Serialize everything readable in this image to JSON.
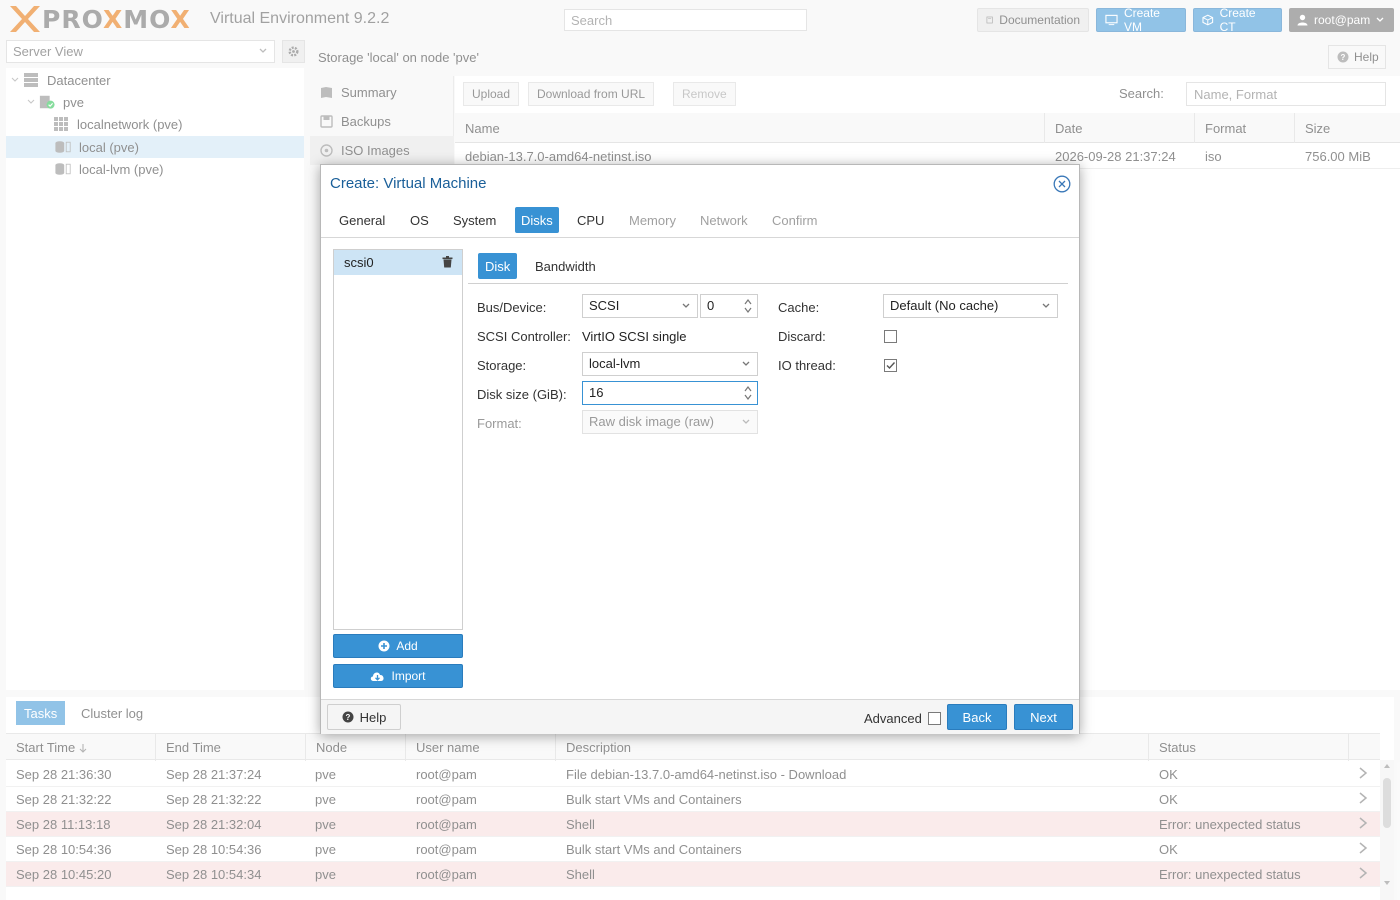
{
  "header": {
    "logo_text": "PROXMOX",
    "version": "Virtual Environment 9.2.2",
    "search_placeholder": "Search",
    "documentation": "Documentation",
    "create_vm": "Create VM",
    "create_ct": "Create CT",
    "user": "root@pam"
  },
  "sidebar": {
    "view": "Server View",
    "tree": [
      {
        "label": "Datacenter"
      },
      {
        "label": "pve"
      },
      {
        "label": "localnetwork (pve)"
      },
      {
        "label": "local (pve)"
      },
      {
        "label": "local-lvm (pve)"
      }
    ]
  },
  "content": {
    "title": "Storage 'local' on node 'pve'",
    "help": "Help",
    "nav": [
      "Summary",
      "Backups",
      "ISO Images"
    ],
    "toolbar": {
      "upload": "Upload",
      "download": "Download from URL",
      "remove": "Remove",
      "search_label": "Search:",
      "search_placeholder": "Name, Format"
    },
    "columns": [
      "Name",
      "Date",
      "Format",
      "Size"
    ],
    "rows": [
      {
        "name": "debian-13.7.0-amd64-netinst.iso",
        "date": "2026-09-28 21:37:24",
        "format": "iso",
        "size": "756.00 MiB"
      }
    ]
  },
  "tasks": {
    "tabs": [
      "Tasks",
      "Cluster log"
    ],
    "columns": [
      "Start Time",
      "End Time",
      "Node",
      "User name",
      "Description",
      "Status"
    ],
    "rows": [
      {
        "start": "Sep 28 21:36:30",
        "end": "Sep 28 21:37:24",
        "node": "pve",
        "user": "root@pam",
        "desc": "File debian-13.7.0-amd64-netinst.iso - Download",
        "status": "OK"
      },
      {
        "start": "Sep 28 21:32:22",
        "end": "Sep 28 21:32:22",
        "node": "pve",
        "user": "root@pam",
        "desc": "Bulk start VMs and Containers",
        "status": "OK"
      },
      {
        "start": "Sep 28 11:13:18",
        "end": "Sep 28 21:32:04",
        "node": "pve",
        "user": "root@pam",
        "desc": "Shell",
        "status": "Error: unexpected status"
      },
      {
        "start": "Sep 28 10:54:36",
        "end": "Sep 28 10:54:36",
        "node": "pve",
        "user": "root@pam",
        "desc": "Bulk start VMs and Containers",
        "status": "OK"
      },
      {
        "start": "Sep 28 10:45:20",
        "end": "Sep 28 10:54:34",
        "node": "pve",
        "user": "root@pam",
        "desc": "Shell",
        "status": "Error: unexpected status"
      }
    ]
  },
  "dialog": {
    "title": "Create: Virtual Machine",
    "tabs": [
      "General",
      "OS",
      "System",
      "Disks",
      "CPU",
      "Memory",
      "Network",
      "Confirm"
    ],
    "active_tab": "Disks",
    "disks": [
      "scsi0"
    ],
    "add": "Add",
    "import": "Import",
    "subtabs": [
      "Disk",
      "Bandwidth"
    ],
    "form": {
      "bus_label": "Bus/Device:",
      "bus_value": "SCSI",
      "device_value": "0",
      "controller_label": "SCSI Controller:",
      "controller_value": "VirtIO SCSI single",
      "storage_label": "Storage:",
      "storage_value": "local-lvm",
      "size_label": "Disk size (GiB):",
      "size_value": "16",
      "format_label": "Format:",
      "format_value": "Raw disk image (raw)",
      "cache_label": "Cache:",
      "cache_value": "Default (No cache)",
      "discard_label": "Discard:",
      "discard_checked": false,
      "iothread_label": "IO thread:",
      "iothread_checked": true
    },
    "footer": {
      "help": "Help",
      "advanced": "Advanced",
      "back": "Back",
      "next": "Next"
    }
  },
  "colors": {
    "accent": "#3892d4",
    "title": "#1a5f99",
    "error_row": "#f6dada",
    "selected": "#cde4f5"
  }
}
